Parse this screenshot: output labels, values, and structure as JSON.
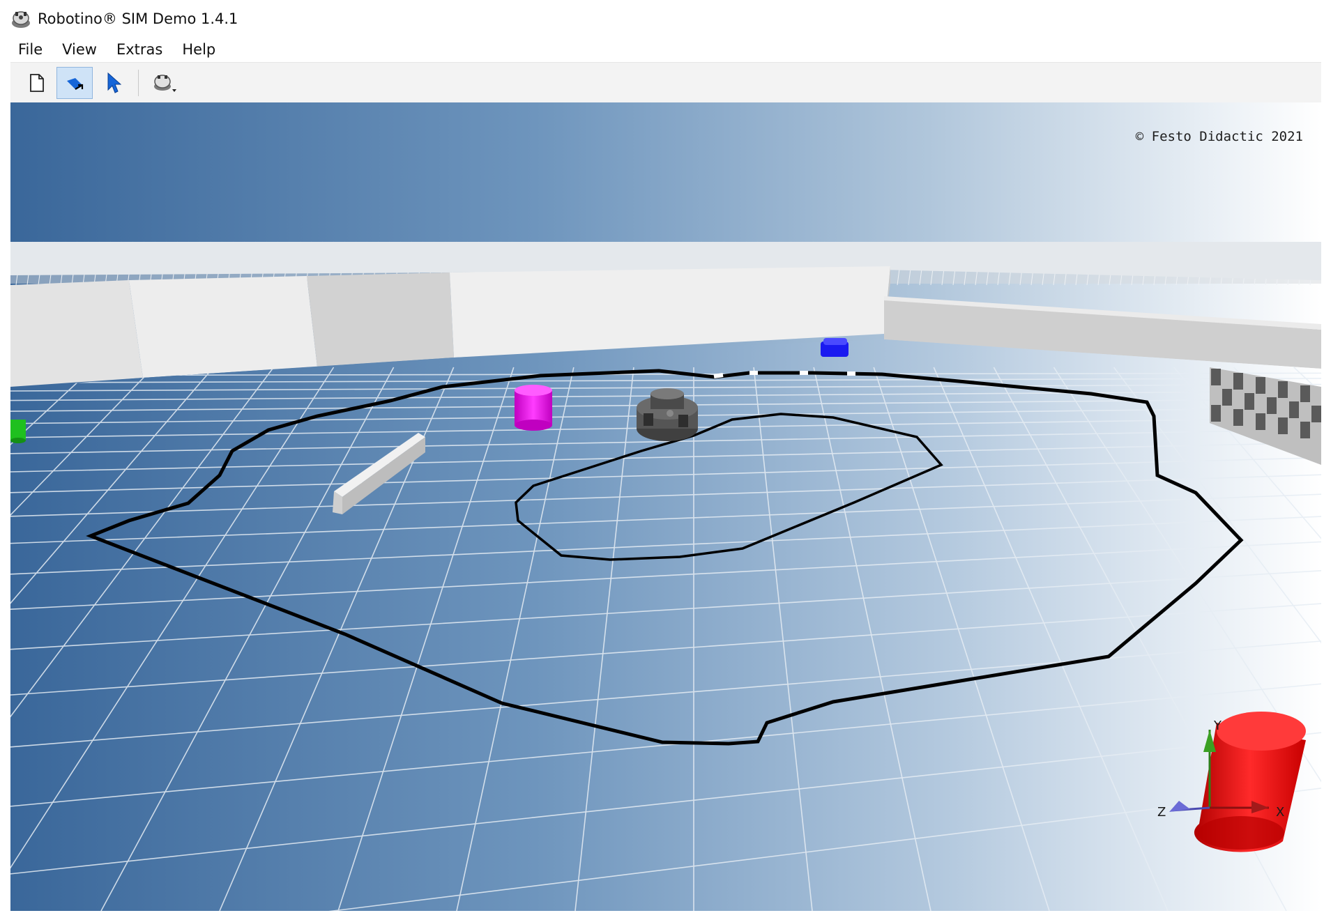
{
  "window": {
    "title": "Robotino® SIM Demo 1.4.1",
    "app_icon": "robotino-icon"
  },
  "menubar": {
    "items": [
      "File",
      "View",
      "Extras",
      "Help"
    ]
  },
  "toolbar": {
    "buttons": [
      {
        "name": "new-scene-button",
        "icon": "document-icon",
        "active": false
      },
      {
        "name": "move-tool-button",
        "icon": "move-arrow-icon",
        "active": true
      },
      {
        "name": "select-tool-button",
        "icon": "pointer-icon",
        "active": false
      },
      {
        "name": "robot-menu-button",
        "icon": "robotino-icon",
        "active": false
      }
    ]
  },
  "viewport": {
    "copyright": "© Festo Didactic 2021",
    "axes": {
      "x_label": "X",
      "y_label": "Y",
      "z_label": "Z"
    },
    "colors": {
      "magenta_cylinder": "#e60ee6",
      "blue_block": "#1a1af0",
      "green_object": "#1fc01f",
      "red_cylinder": "#ee1111",
      "track_line": "#000000"
    }
  }
}
